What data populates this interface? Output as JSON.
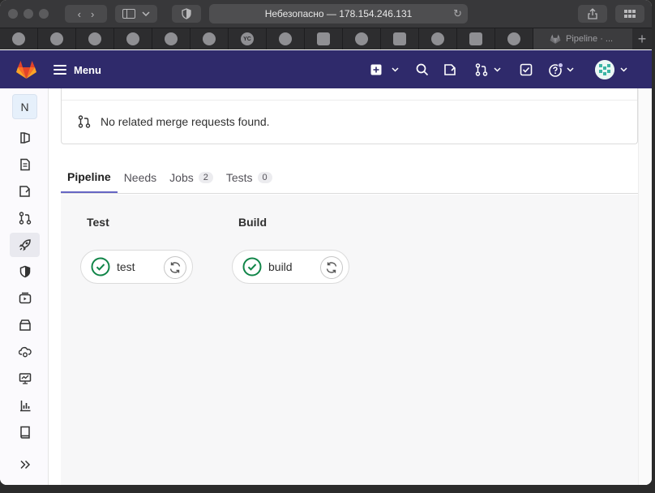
{
  "browser": {
    "address": "Небезопасно — 178.154.246.131",
    "favorites": [
      {
        "icon": "hub-icon"
      },
      {
        "icon": "github-icon"
      },
      {
        "icon": "github-icon"
      },
      {
        "icon": "github-icon"
      },
      {
        "icon": "github-icon"
      },
      {
        "icon": "github-icon"
      },
      {
        "icon": "yc-icon",
        "text": "YC"
      },
      {
        "icon": "hub-icon"
      },
      {
        "icon": "doc-icon"
      },
      {
        "icon": "grammarly-icon"
      },
      {
        "icon": "stack-icon"
      },
      {
        "icon": "grammarly-icon"
      },
      {
        "icon": "grid-icon"
      },
      {
        "icon": "loader-icon"
      }
    ],
    "active_tab": "Pipeline · ..."
  },
  "header": {
    "menu_label": "Menu"
  },
  "sidebar": {
    "project_letter": "N",
    "items": [
      "project-overview-icon",
      "repository-icon",
      "issues-icon",
      "merge-requests-icon",
      "ci-cd-icon",
      "security-icon",
      "deployments-icon",
      "packages-icon",
      "infrastructure-icon",
      "monitor-icon",
      "analytics-icon",
      "wiki-icon",
      "collapse-icon"
    ]
  },
  "main": {
    "related_mr_text": "No related merge requests found.",
    "tabs": [
      {
        "label": "Pipeline",
        "active": true
      },
      {
        "label": "Needs"
      },
      {
        "label": "Jobs",
        "count": "2"
      },
      {
        "label": "Tests",
        "count": "0"
      }
    ],
    "stages": [
      {
        "title": "Test",
        "job": "test",
        "status": "passed"
      },
      {
        "title": "Build",
        "job": "build",
        "status": "passed"
      }
    ]
  },
  "colors": {
    "header_bg": "#2f2a6b",
    "success": "#108548",
    "active_tab_underline": "#6666c4"
  }
}
